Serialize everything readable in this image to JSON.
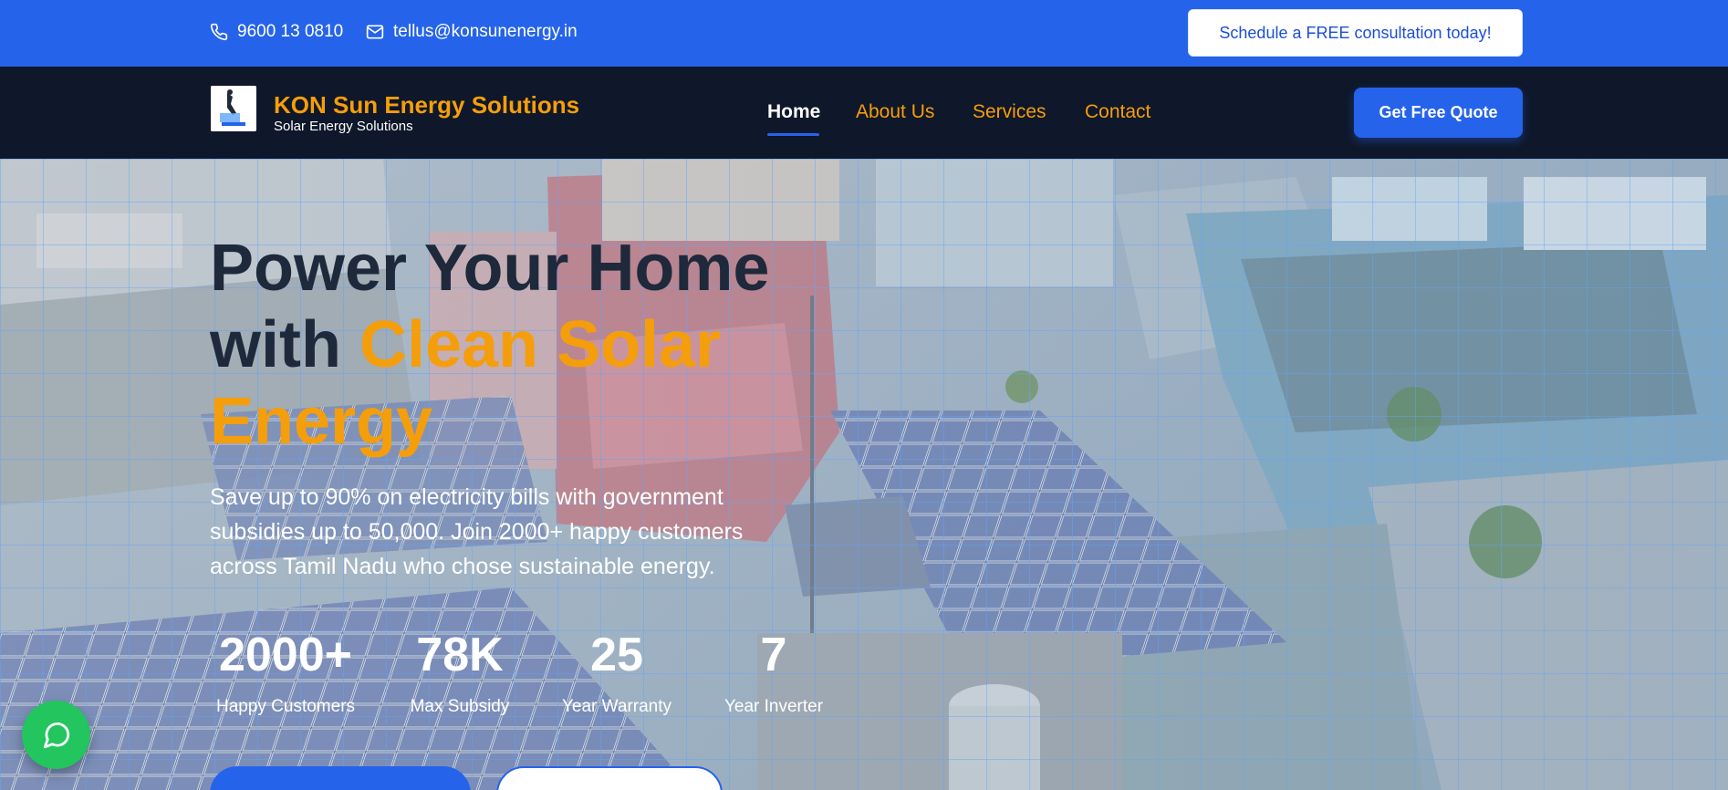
{
  "topbar": {
    "phone": "9600 13 0810",
    "email": "tellus@konsunenergy.in",
    "consult_label": "Schedule a FREE consultation today!"
  },
  "brand": {
    "name": "KON Sun Energy Solutions",
    "tagline": "Solar Energy Solutions"
  },
  "nav": {
    "items": [
      {
        "label": "Home",
        "active": true
      },
      {
        "label": "About Us"
      },
      {
        "label": "Services"
      },
      {
        "label": "Contact"
      }
    ],
    "quote_label": "Get Free Quote"
  },
  "hero": {
    "headline_part1": "Power Your Home",
    "headline_part2": "with ",
    "headline_highlight1": "Clean Solar",
    "headline_highlight2": "Energy",
    "subtext": "Save up to 90% on electricity bills with government subsidies up to 50,000. Join 2000+ happy customers across Tamil Nadu who chose sustainable energy.",
    "stats": [
      {
        "value": "2000+",
        "label": "Happy Customers"
      },
      {
        "value": "78K",
        "label": "Max Subsidy"
      },
      {
        "value": "25",
        "label": "Year Warranty"
      },
      {
        "value": "7",
        "label": "Year Inverter"
      }
    ]
  },
  "colors": {
    "primary": "#2563eb",
    "accent": "#f59e0b",
    "nav_bg": "#0f172a",
    "chat": "#22c55e"
  },
  "icons": {
    "phone": "phone-icon",
    "email": "mail-icon",
    "chat": "chat-bubble-icon"
  }
}
